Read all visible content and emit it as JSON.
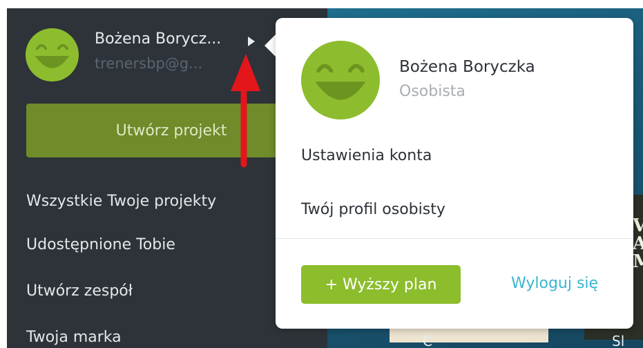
{
  "sidebar": {
    "user_name": "Bożena Borycz...",
    "user_email": "trenersbp@g...",
    "create_button": "Utwórz projekt",
    "nav": [
      "Wszystkie Twoje projekty",
      "Udostępnione Tobie",
      "Utwórz zespół",
      "Twoja marka"
    ]
  },
  "popup": {
    "name": "Bożena Boryczka",
    "plan": "Osobista",
    "links": [
      "Ustawienia konta",
      "Twój profil osobisty"
    ],
    "upgrade_button": "+ Wyższy plan",
    "logout": "Wyloguj się"
  },
  "background": {
    "letters": "VE\nAN\nM",
    "bottom_text_left": "C",
    "bottom_text_right": "Sl"
  },
  "colors": {
    "sidebar_bg": "#2e3339",
    "accent_green": "#8cbd2c",
    "create_button_green": "#6f8b2a",
    "logout_blue": "#38b6cf",
    "annotation_red": "#e3161c"
  },
  "icons": {
    "avatar": "smiley-face-icon",
    "caret": "caret-right-icon",
    "annotation": "red-arrow-up-icon"
  }
}
